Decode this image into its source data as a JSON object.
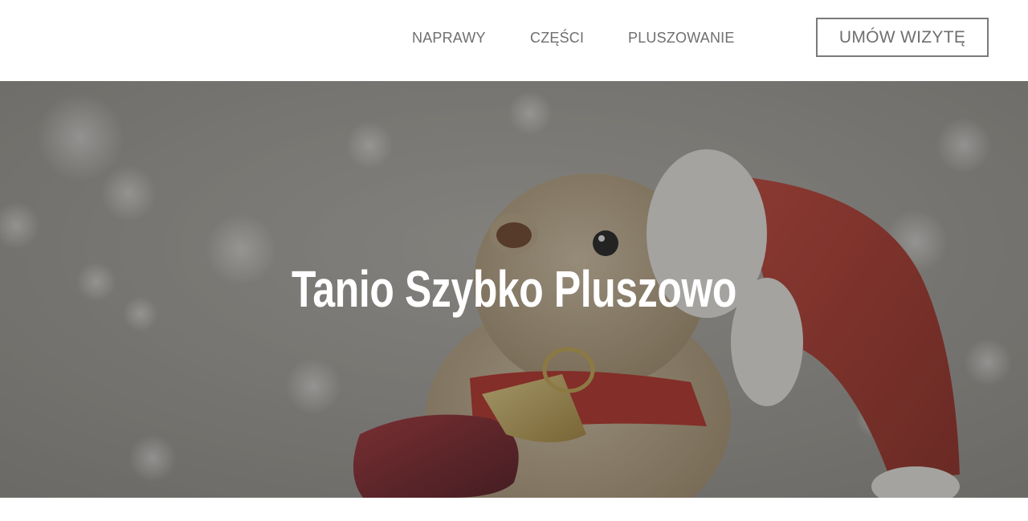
{
  "nav": {
    "items": [
      {
        "label": "NAPRAWY"
      },
      {
        "label": "CZĘŚCI"
      },
      {
        "label": "PLUSZOWANIE"
      }
    ],
    "cta_label": "UMÓW WIZYTĘ"
  },
  "hero": {
    "title": "Tanio Szybko Pluszowo"
  },
  "colors": {
    "nav_text": "#6f6f6f",
    "cta_border": "#7a7a7a",
    "hero_overlay": "#3a3a3a",
    "hat_red": "#a8281e"
  }
}
